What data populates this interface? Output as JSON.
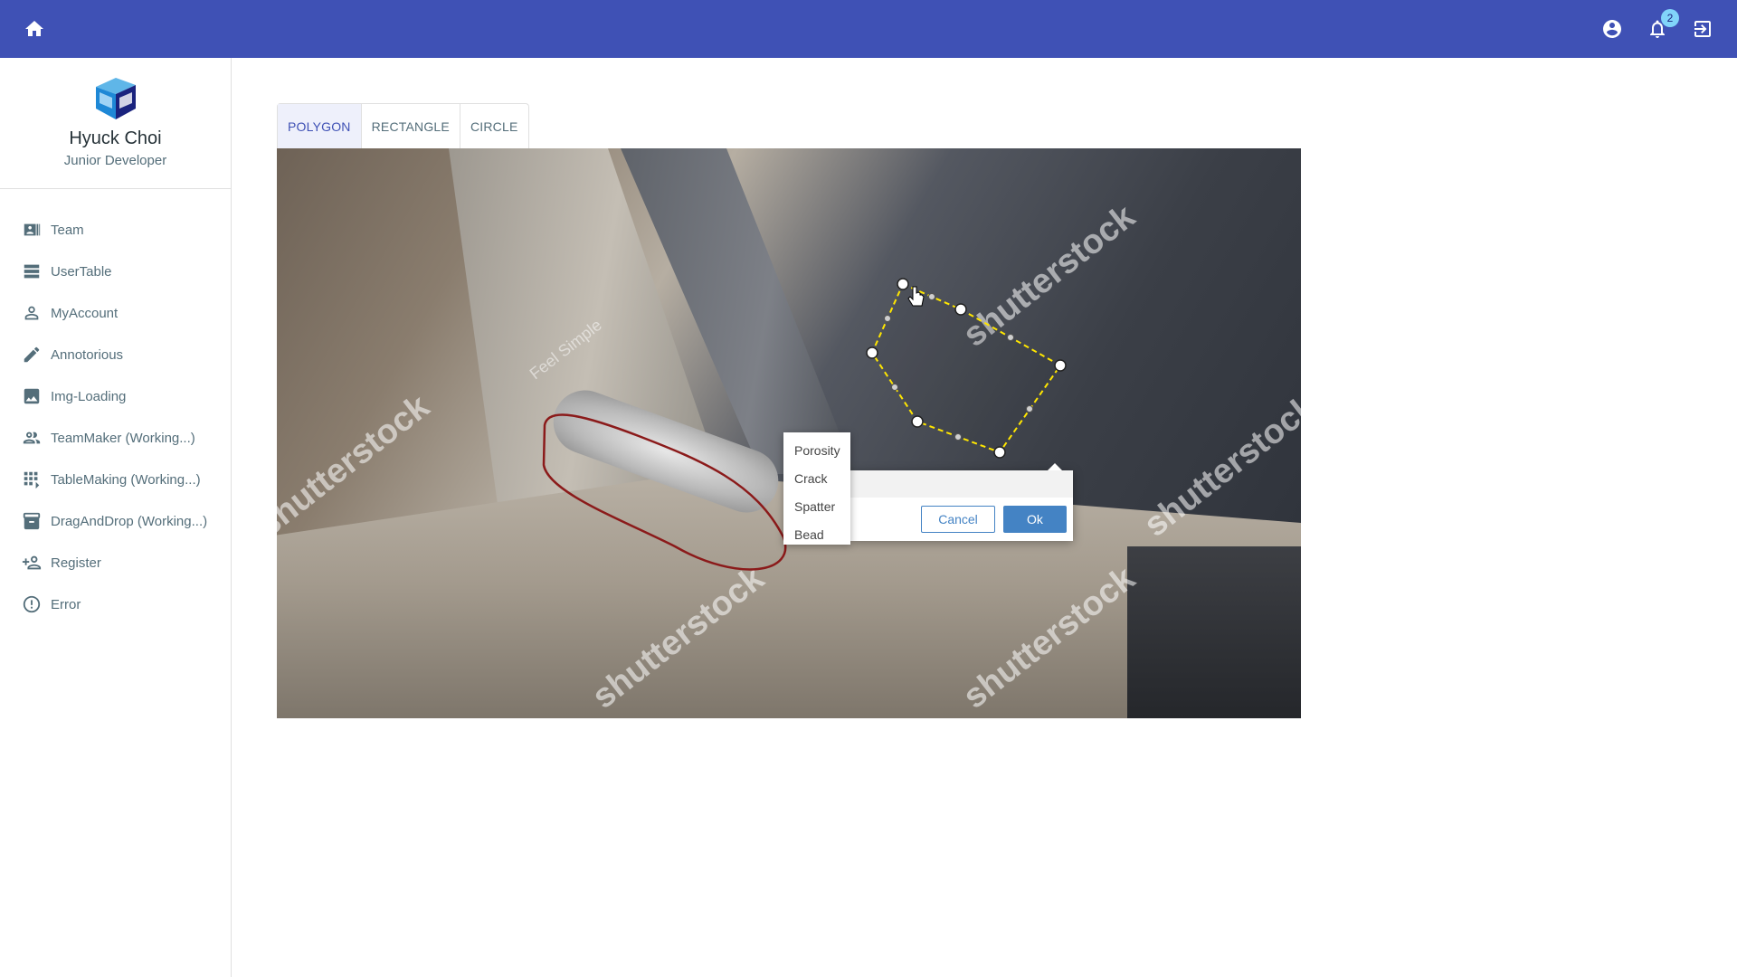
{
  "topbar": {
    "home_icon": "home-icon",
    "account_icon": "account-circle-icon",
    "notifications_icon": "bell-icon",
    "notifications_count": "2",
    "logout_icon": "logout-icon"
  },
  "profile": {
    "name": "Hyuck Choi",
    "role": "Junior Developer"
  },
  "sidebar": {
    "items": [
      {
        "label": "Team",
        "icon": "team-card-icon"
      },
      {
        "label": "UserTable",
        "icon": "table-rows-icon"
      },
      {
        "label": "MyAccount",
        "icon": "person-icon"
      },
      {
        "label": "Annotorious",
        "icon": "pencil-icon"
      },
      {
        "label": "Img-Loading",
        "icon": "image-icon"
      },
      {
        "label": "TeamMaker (Working...)",
        "icon": "people-icon"
      },
      {
        "label": "TableMaking (Working...)",
        "icon": "grid-icon"
      },
      {
        "label": "DragAndDrop (Working...)",
        "icon": "archive-icon"
      },
      {
        "label": "Register",
        "icon": "person-add-icon"
      },
      {
        "label": "Error",
        "icon": "error-outline-icon"
      }
    ]
  },
  "tabs": [
    {
      "label": "POLYGON"
    },
    {
      "label": "RECTANGLE"
    },
    {
      "label": "CIRCLE"
    }
  ],
  "active_tab": "POLYGON",
  "image": {
    "watermark": "shutterstock",
    "overlay_text": "Feel Simple"
  },
  "tag_dropdown": {
    "options": [
      "Porosity",
      "Crack",
      "Spatter",
      "Bead"
    ]
  },
  "popup": {
    "cancel_label": "Cancel",
    "ok_label": "Ok"
  },
  "colors": {
    "appbar": "#3f51b5",
    "polygon_stroke": "#ffe600",
    "saved_shape_stroke": "#8b1a1a",
    "button_blue": "#4483c4"
  }
}
